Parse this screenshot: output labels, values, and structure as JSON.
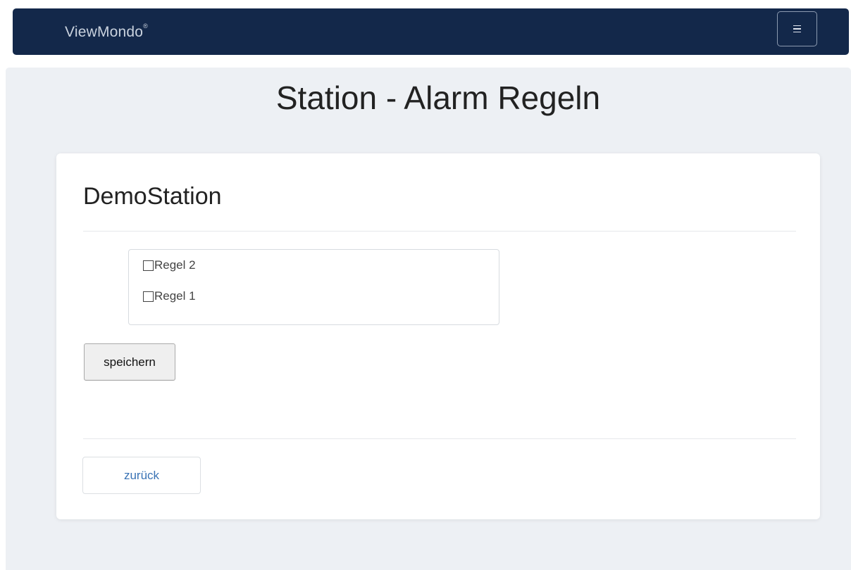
{
  "navbar": {
    "brand": "ViewMondo",
    "brand_mark": "®",
    "menu_icon": "hamburger-icon",
    "background_color": "#13284a"
  },
  "page": {
    "title": "Station - Alarm Regeln"
  },
  "panel": {
    "station_name": "DemoStation",
    "rules": [
      {
        "label": "Regel 2",
        "checked": false
      },
      {
        "label": "Regel 1",
        "checked": false
      }
    ],
    "save_label": "speichern",
    "back_label": "zurück"
  },
  "colors": {
    "link": "#3a73b5",
    "background": "#edf0f4"
  }
}
